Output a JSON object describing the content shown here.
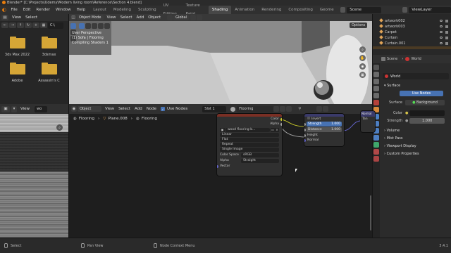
{
  "titlebar": {
    "text": "Blender* [C:\\Projects\\Udemy\\Modern living room\\Reference\\Section 4.blend]"
  },
  "menu": [
    "File",
    "Edit",
    "Render",
    "Window",
    "Help"
  ],
  "workspaces": [
    "Layout",
    "Modeling",
    "Sculpting",
    "UV Editing",
    "Texture Paint",
    "Shading",
    "Animation",
    "Rendering",
    "Compositing",
    "Geome"
  ],
  "active_workspace": "Shading",
  "scene_name": "Scene",
  "view_layer": "ViewLayer",
  "filebrowser": {
    "header_items": [
      "View",
      "Select"
    ],
    "path": "C:\\",
    "folders": [
      "3ds Max 2022",
      "3dsmax",
      "Adobe",
      "Assassin's C"
    ]
  },
  "imgview": {
    "header_items": [
      "View"
    ],
    "header_field": "wo"
  },
  "viewport": {
    "mode": "Object Mode",
    "menus": [
      "View",
      "Select",
      "Add",
      "Object"
    ],
    "transform": "Global",
    "options_label": "Options",
    "overlay_lines": [
      "User Perspective",
      "(1) Sofa | Flooring",
      "Compiling Shaders 1"
    ]
  },
  "outliner": {
    "rows": [
      "artwork002",
      "artwork003",
      "Carpet",
      "Curtain",
      "Curtain.001"
    ]
  },
  "props": {
    "breadcrumb": [
      "Scene",
      "World"
    ],
    "world_name": "World",
    "surface_label": "Surface",
    "use_nodes_label": "Use Nodes",
    "surface_field_label": "Surface",
    "surface_value": "Background",
    "color_label": "Color",
    "strength_label": "Strength",
    "strength_value": "1.000",
    "panels": [
      "Volume",
      "Mist Pass",
      "Viewport Display",
      "Custom Properties"
    ]
  },
  "node_editor": {
    "mode": "Object",
    "menus": [
      "View",
      "Select",
      "Add",
      "Node"
    ],
    "use_nodes_label": "Use Nodes",
    "slot": "Slot 1",
    "material": "Flooring",
    "breadcrumb": [
      "Flooring",
      "Plane.008",
      "Flooring"
    ],
    "image_node": {
      "outputs": [
        "Color",
        "Alpha"
      ],
      "image_name": "wood flooring-b...",
      "interpolation": "Linear",
      "projection": "Flat",
      "extension": "Repeat",
      "source": "Single Image",
      "colorspace_label": "Color Space",
      "colorspace": "sRGB",
      "alpha_label": "Alpha",
      "alpha": "Straight",
      "vector_label": "Vector"
    },
    "bump_node": {
      "invert_label": "Invert",
      "strength_label": "Strength",
      "strength": "1.000",
      "distance_label": "Distance",
      "distance": "1.000",
      "height_label": "Height",
      "normal_label": "Normal"
    },
    "bsdf_node": {
      "title": "Normal",
      "label": "Tan"
    }
  },
  "statusbar": {
    "left": "Select",
    "middle": "Pan View",
    "right": "Node Context Menu",
    "version": "3.4.1"
  }
}
